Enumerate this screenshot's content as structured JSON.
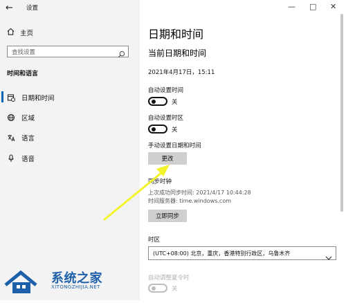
{
  "window": {
    "app_title": "设置",
    "controls": {
      "minimize": "—",
      "maximize": "□",
      "close": "✕"
    }
  },
  "sidebar": {
    "home_label": "主页",
    "search_placeholder": "查找设置",
    "section_title": "时间和语言",
    "items": [
      {
        "label": "日期和时间",
        "icon": "calendar-clock-icon",
        "active": true
      },
      {
        "label": "区域",
        "icon": "globe-icon",
        "active": false
      },
      {
        "label": "语言",
        "icon": "language-icon",
        "active": false
      },
      {
        "label": "语音",
        "icon": "microphone-icon",
        "active": false
      }
    ]
  },
  "main": {
    "title": "日期和时间",
    "subtitle": "当前日期和时间",
    "current_datetime": "2021年4月17日，15:11",
    "auto_time": {
      "label": "自动设置时间",
      "state_text": "关",
      "on": false
    },
    "auto_timezone": {
      "label": "自动设置时区",
      "state_text": "关",
      "on": false
    },
    "manual": {
      "label": "手动设置日期和时间",
      "button": "更改"
    },
    "sync": {
      "title": "同步时钟",
      "last_sync": "上次成功同步时间: 2021/4/17 10:44:28",
      "server": "时间服务器: time.windows.com",
      "button": "立即同步"
    },
    "timezone": {
      "label": "时区",
      "selected": "(UTC+08:00) 北京，重庆，香港特别行政区，乌鲁木齐"
    },
    "dst": {
      "label": "自动调整夏令时",
      "state_text": "关",
      "on": false,
      "disabled": true
    }
  },
  "watermark": {
    "title": "系统之家",
    "subtitle": "XITONGZHIJIA.NET"
  },
  "colors": {
    "accent": "#0063b1",
    "arrow": "#f3f32a",
    "sidebar_bg": "#f3f3f3",
    "button_bg": "#cfcfcf",
    "watermark": "#1d5fa8"
  }
}
